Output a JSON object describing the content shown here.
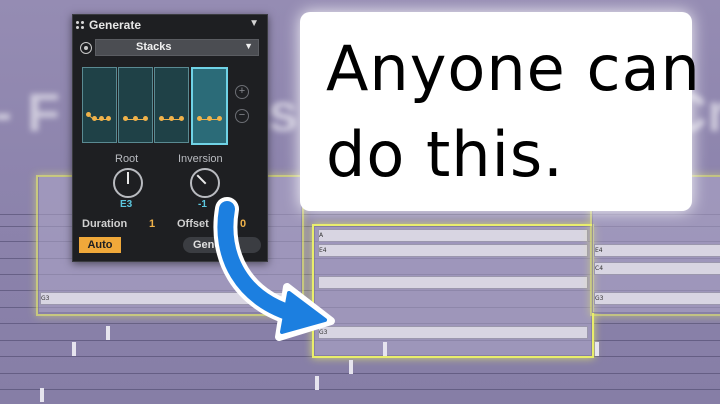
{
  "background": {
    "blurred_text_left": "- F",
    "blurred_text_mid": "s",
    "blurred_text_right": "Cr"
  },
  "plugin": {
    "title": "Generate",
    "preset": "Stacks",
    "knobs": [
      {
        "label": "Root",
        "value": "E3"
      },
      {
        "label": "Inversion",
        "value": "-1"
      }
    ],
    "params": [
      {
        "label": "Duration",
        "value": "1"
      },
      {
        "label": "Offset",
        "value": "0"
      }
    ],
    "auto_label": "Auto",
    "generate_label": "Gene",
    "selected_slot": 4,
    "colors": {
      "accent": "#f0a83a",
      "knob_value": "#5cc8e0",
      "slot_selected": "#70d3e6"
    }
  },
  "piano_roll": {
    "notes_left": [
      "G3"
    ],
    "notes_highlight": [
      "A",
      "E4",
      "G3"
    ],
    "notes_right": [
      "E4",
      "C4",
      "G3"
    ],
    "highlight_color": "#e9ee6a"
  },
  "callout": {
    "line1": "Anyone can",
    "line2": "do this."
  },
  "arrow": {
    "color": "#1c7fe0"
  }
}
